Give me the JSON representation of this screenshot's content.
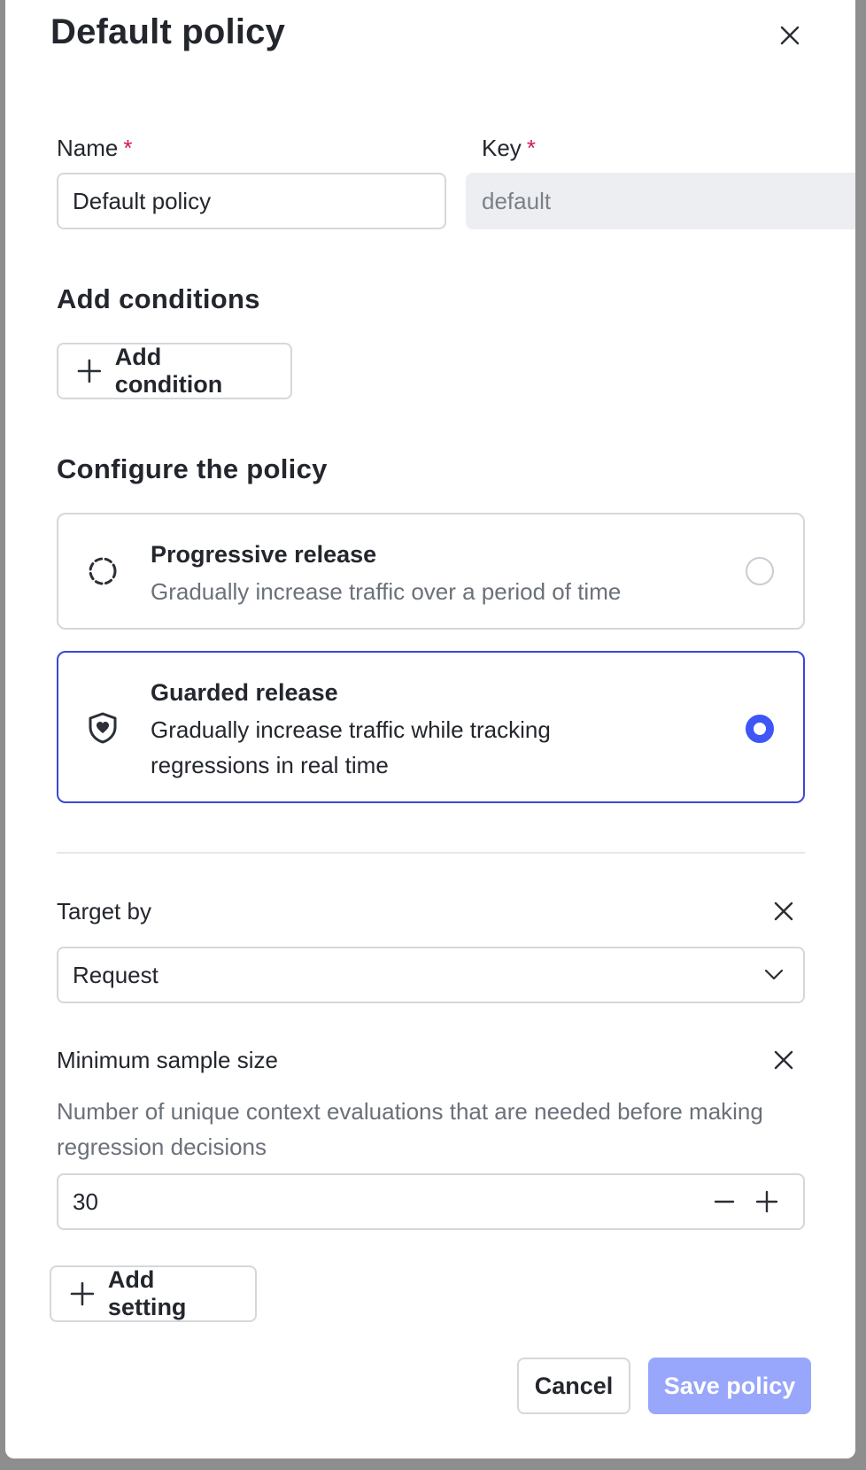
{
  "dialog": {
    "title": "Default policy"
  },
  "fields": {
    "name": {
      "label": "Name",
      "required_mark": "*",
      "value": "Default policy"
    },
    "key": {
      "label": "Key",
      "required_mark": "*",
      "value": "default"
    }
  },
  "conditions": {
    "heading": "Add conditions",
    "add_button_label": "Add condition"
  },
  "configure": {
    "heading": "Configure the policy",
    "options": [
      {
        "title": "Progressive release",
        "description": "Gradually increase traffic over a period of time",
        "selected": false,
        "icon": "progress-circle-icon"
      },
      {
        "title": "Guarded release",
        "description": "Gradually increase traffic while tracking regressions in real time",
        "selected": true,
        "icon": "shield-heart-icon"
      }
    ]
  },
  "settings": {
    "target_by": {
      "label": "Target by",
      "value": "Request"
    },
    "min_sample": {
      "label": "Minimum sample size",
      "helper": "Number of unique context evaluations that are needed before making regression decisions",
      "value": "30"
    },
    "add_setting_label": "Add setting"
  },
  "footer": {
    "cancel_label": "Cancel",
    "save_label": "Save policy"
  },
  "colors": {
    "accent": "#3d56f5",
    "selected_border": "#3b48d4",
    "save_disabled": "#98a6fb",
    "required": "#d6194b"
  }
}
